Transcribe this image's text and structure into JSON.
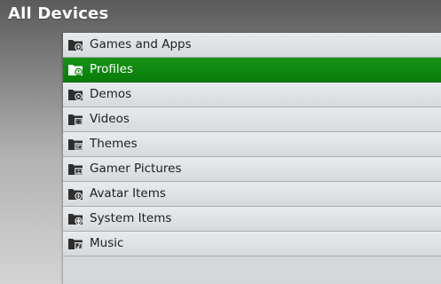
{
  "header": {
    "title": "All Devices"
  },
  "colors": {
    "selected_accent": "#0f870f",
    "text_default": "#1e1e1e",
    "text_selected": "#ffffff"
  },
  "list": {
    "selected_index": 1,
    "items": [
      {
        "label": "Games and Apps",
        "icon": "games-folder-icon"
      },
      {
        "label": "Profiles",
        "icon": "profiles-folder-icon"
      },
      {
        "label": "Demos",
        "icon": "demos-folder-icon"
      },
      {
        "label": "Videos",
        "icon": "videos-folder-icon"
      },
      {
        "label": "Themes",
        "icon": "themes-folder-icon"
      },
      {
        "label": "Gamer Pictures",
        "icon": "gamer-pictures-folder-icon"
      },
      {
        "label": "Avatar Items",
        "icon": "avatar-items-folder-icon"
      },
      {
        "label": "System Items",
        "icon": "system-items-folder-icon"
      },
      {
        "label": "Music",
        "icon": "music-folder-icon"
      }
    ]
  }
}
